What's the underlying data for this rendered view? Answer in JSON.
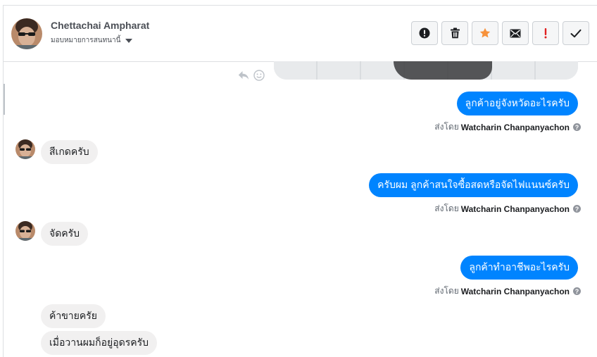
{
  "header": {
    "contact_name": "Chettachai Ampharat",
    "assign_label": "มอบหมายการสนทนานี้",
    "toolbar": [
      {
        "name": "mark-spam-button",
        "icon": "exclamation-circle-icon"
      },
      {
        "name": "delete-button",
        "icon": "trash-icon"
      },
      {
        "name": "star-button",
        "icon": "star-icon",
        "color": "#f7923b"
      },
      {
        "name": "mark-unread-button",
        "icon": "envelope-icon"
      },
      {
        "name": "follow-up-button",
        "icon": "exclamation-icon",
        "color": "#e02020"
      },
      {
        "name": "mark-done-button",
        "icon": "checkmark-icon"
      }
    ]
  },
  "colors": {
    "outgoing_bubble": "#0084ff",
    "incoming_bubble": "#f1f0f0"
  },
  "messages": {
    "m1": {
      "text": "ลูกค้าอยู่จังหวัดอะไรครับ",
      "direction": "out"
    },
    "m1_sent_prefix": "ส่งโดย",
    "m1_sender": "Watcharin Chanpanyachon",
    "m2": {
      "text": "สีเกดครับ",
      "direction": "in"
    },
    "m3": {
      "text": "ครับผม ลูกค้าสนใจซื้อสดหรือจัดไฟแนนซ์ครับ",
      "direction": "out"
    },
    "m3_sent_prefix": "ส่งโดย",
    "m3_sender": "Watcharin Chanpanyachon",
    "m4": {
      "text": "จัดครับ",
      "direction": "in"
    },
    "m5": {
      "text": "ลูกค้าทำอาชีพอะไรครับ",
      "direction": "out"
    },
    "m5_sent_prefix": "ส่งโดย",
    "m5_sender": "Watcharin Chanpanyachon",
    "m6": {
      "text": "ค้าขายครัย",
      "direction": "in"
    },
    "m7": {
      "text": "เมื่อวานผมก็อยู่อุดรครับ",
      "direction": "in"
    }
  },
  "icons": {
    "reply": "reply-icon",
    "react": "smiley-icon",
    "help": "question-circle-icon"
  }
}
